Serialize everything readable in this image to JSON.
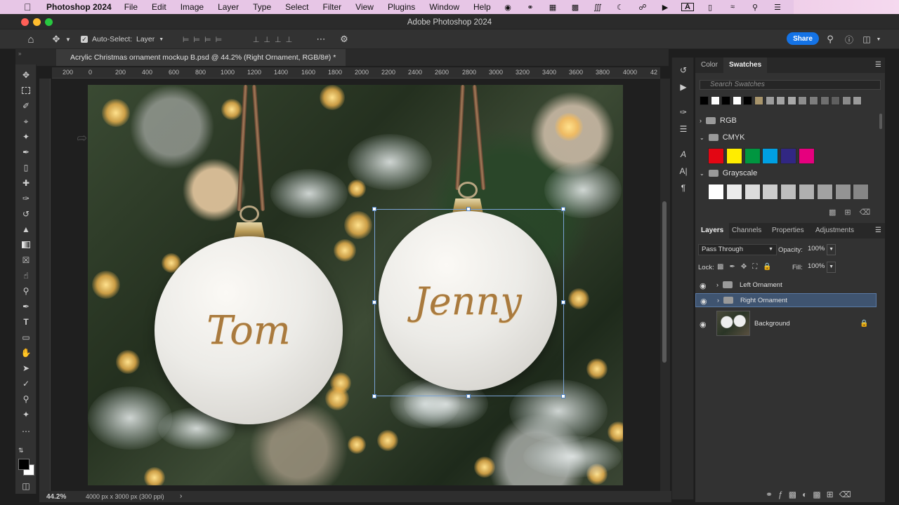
{
  "menubar": {
    "app_name": "Photoshop 2024",
    "items": [
      "File",
      "Edit",
      "Image",
      "Layer",
      "Type",
      "Select",
      "Filter",
      "View",
      "Plugins",
      "Window",
      "Help"
    ]
  },
  "window": {
    "title": "Adobe Photoshop 2024"
  },
  "options_bar": {
    "auto_select_label": "Auto-Select:",
    "auto_select_value": "Layer",
    "share_label": "Share"
  },
  "document": {
    "tab_title": "Acrylic Christmas ornament mockup B.psd @ 44.2% (Right Ornament, RGB/8#) *"
  },
  "ruler": {
    "h_labels": [
      "200",
      "0",
      "200",
      "400",
      "600",
      "800",
      "1000",
      "1200",
      "1400",
      "1600",
      "1800",
      "2000",
      "2200",
      "2400",
      "2600",
      "2800",
      "3000",
      "3200",
      "3400",
      "3600",
      "3800",
      "4000",
      "42"
    ]
  },
  "canvas": {
    "left_ornament_text": "Tom",
    "right_ornament_text": "Jenny"
  },
  "status_bar": {
    "zoom": "44.2%",
    "doc_info": "4000 px x 3000 px (300 ppi)",
    "arrow": "›"
  },
  "swatches_panel": {
    "tabs": [
      "Color",
      "Swatches"
    ],
    "active_tab": "Swatches",
    "search_placeholder": "Search Swatches",
    "recent": [
      "#000000",
      "#ffffff",
      "#000000",
      "#ffffff",
      "#000000",
      "#a8956c",
      "#9c9c9c",
      "#a3a3a3",
      "#a9a9a9",
      "#8d8d8d",
      "#7d7d7d",
      "#6f6f6f",
      "#5f5f5f",
      "#8a8a8a",
      "#9a9a9a"
    ],
    "groups": [
      {
        "name": "RGB",
        "expanded": false
      },
      {
        "name": "CMYK",
        "expanded": true,
        "colors": [
          "#e30613",
          "#ffed00",
          "#009640",
          "#00a0e3",
          "#312783",
          "#e6007e"
        ]
      },
      {
        "name": "Grayscale",
        "expanded": true,
        "colors": [
          "#ffffff",
          "#ececec",
          "#dcdcdc",
          "#cdcdcd",
          "#bebebe",
          "#b0b0b0",
          "#a2a2a2",
          "#949494",
          "#868686"
        ]
      }
    ]
  },
  "layers_panel": {
    "tabs": [
      "Layers",
      "Channels",
      "Properties",
      "Adjustments"
    ],
    "active_tab": "Layers",
    "blend_mode": "Pass Through",
    "opacity_label": "Opacity:",
    "opacity_value": "100%",
    "lock_label": "Lock:",
    "fill_label": "Fill:",
    "fill_value": "100%",
    "layers": [
      {
        "name": "Left Ornament",
        "type": "group",
        "selected": false
      },
      {
        "name": "Right Ornament",
        "type": "group",
        "selected": true
      },
      {
        "name": "Background",
        "type": "image",
        "selected": false,
        "locked": true
      }
    ]
  }
}
